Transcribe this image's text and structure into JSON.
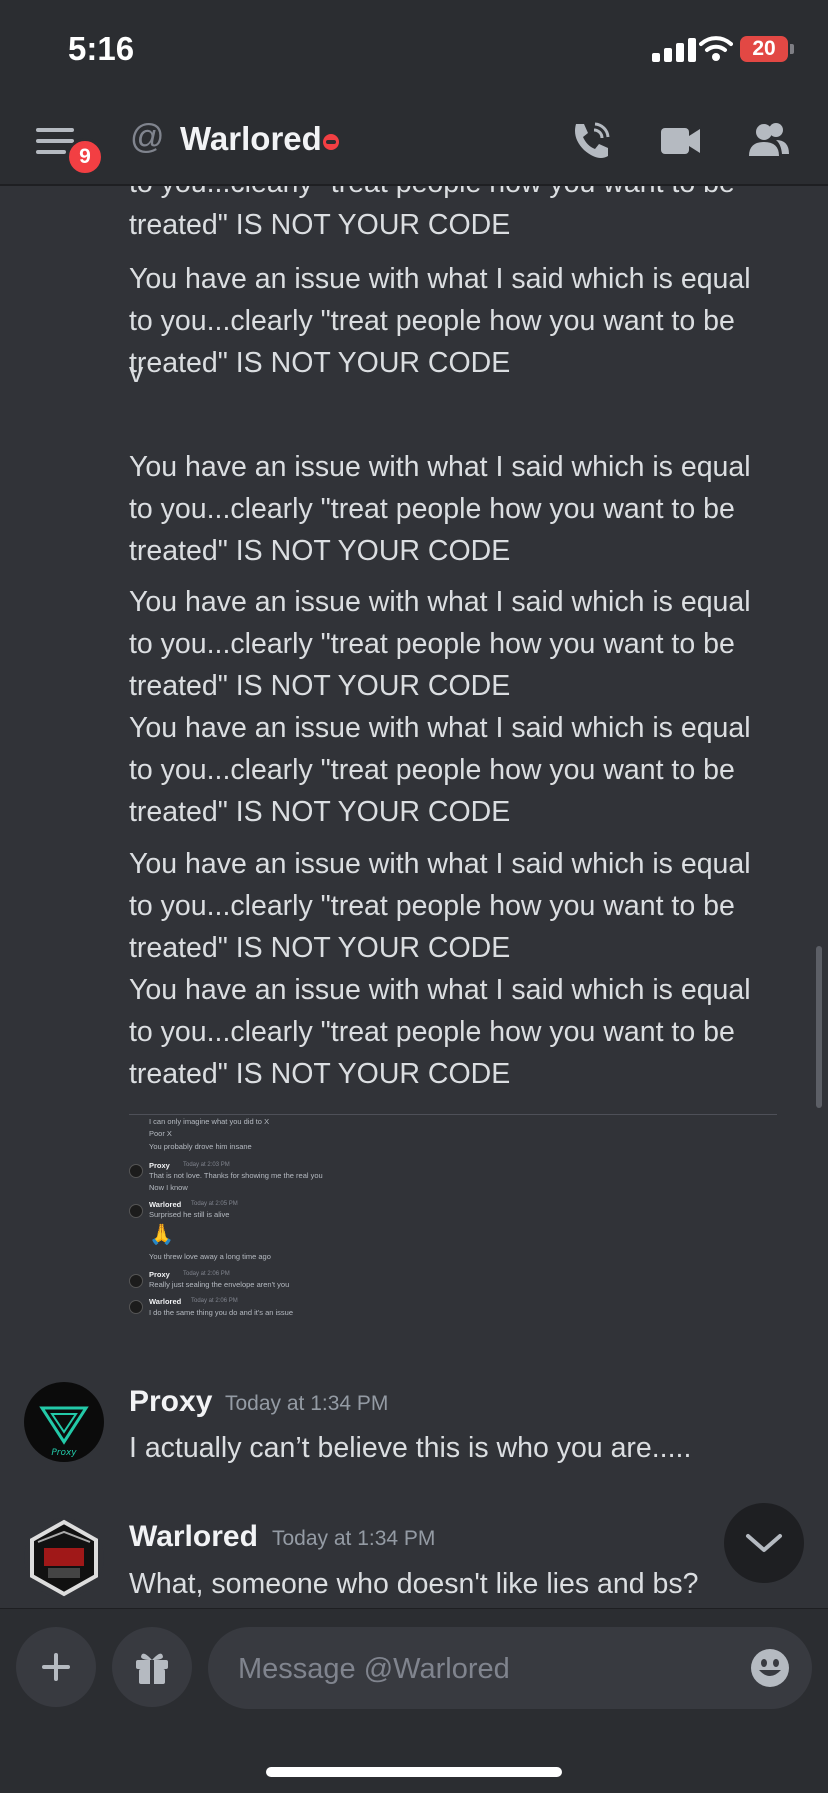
{
  "status_bar": {
    "time": "5:16",
    "battery": "20"
  },
  "header": {
    "badge_count": "9",
    "at_symbol": "@",
    "title": "Warlored"
  },
  "messages": {
    "partial_top": [
      "to you...clearly \"treat people how you want to be",
      "treated\" IS NOT YOUR CODE"
    ],
    "repeat_lines": [
      "You have an issue with what I said which is equal",
      "to you...clearly \"treat people how you want to be",
      "treated\" IS NOT YOUR CODE"
    ],
    "single_v": "v"
  },
  "embed_screenshot": {
    "lines": [
      "I can only imagine what you did to X",
      "Poor X",
      "You probably drove him insane"
    ],
    "items": [
      {
        "name": "Proxy",
        "time": "Today at 2:03 PM",
        "lines": [
          "That is not love. Thanks for showing me the real you",
          "Now I know"
        ]
      },
      {
        "name": "Warlored",
        "time": "Today at 2:05 PM",
        "lines": [
          "Surprised he still is alive",
          "🙏",
          "You threw love away a long time ago"
        ]
      },
      {
        "name": "Proxy",
        "time": "Today at 2:06 PM",
        "lines": [
          "Really just sealing the envelope aren't you"
        ]
      },
      {
        "name": "Warlored",
        "time": "Today at 2:06 PM",
        "lines": [
          "I do the same thing you do and it's an issue"
        ]
      }
    ]
  },
  "proxy_message": {
    "author": "Proxy",
    "timestamp": "Today at 1:34 PM",
    "text": "I actually can’t believe this is who you are.....",
    "avatar_text": "Proxy"
  },
  "warlored_message": {
    "author": "Warlored",
    "timestamp": "Today at 1:34 PM",
    "text": "What, someone who doesn't like lies and bs?"
  },
  "composer": {
    "placeholder": "Message @Warlored"
  },
  "colors": {
    "background": "#313338",
    "header": "#2b2d31",
    "badge": "#f23f43",
    "text": "#dbdee1"
  }
}
